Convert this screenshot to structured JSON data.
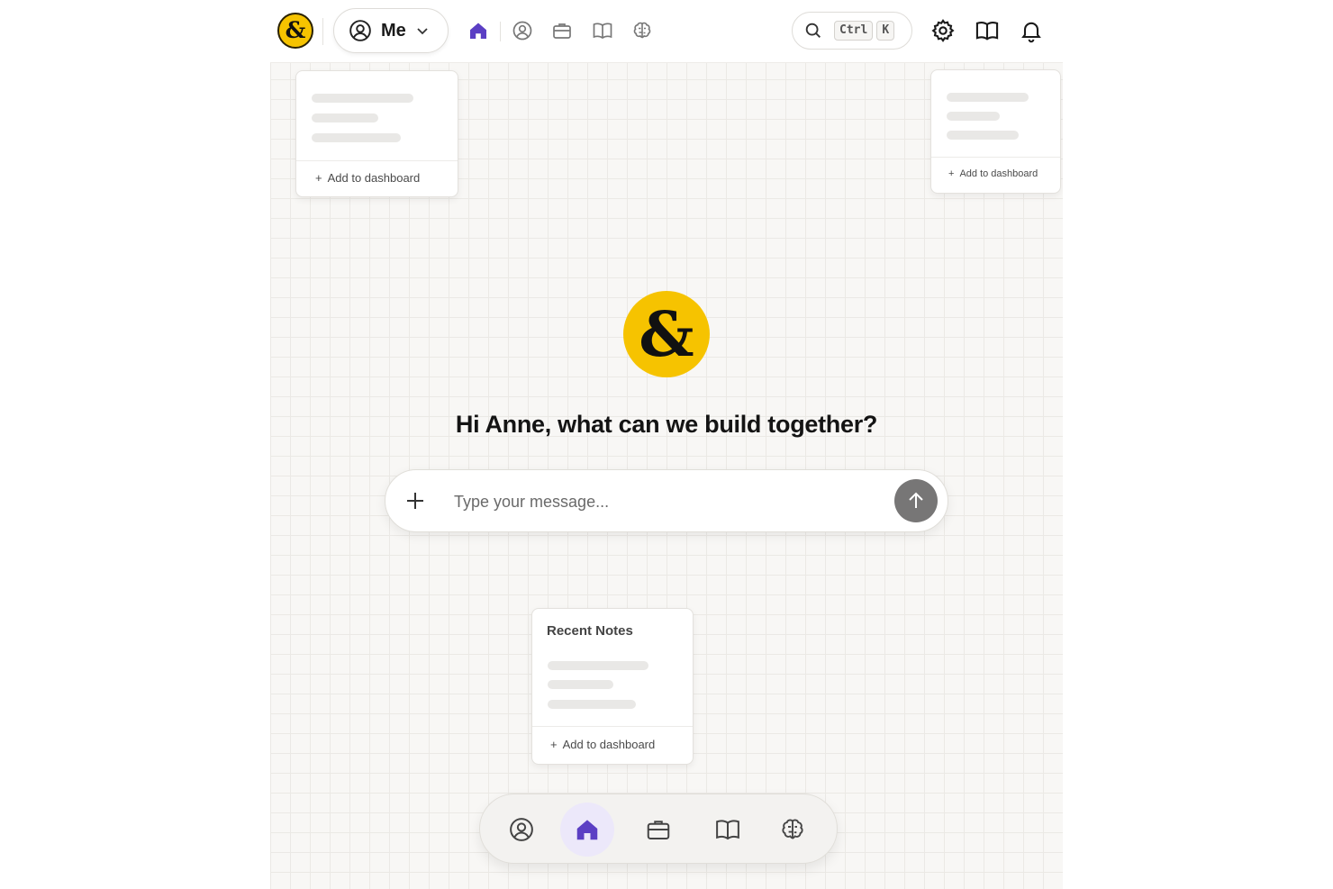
{
  "topbar": {
    "logo_name": "ampersand-logo",
    "profile_selector": {
      "label": "Me"
    },
    "nav_icons": [
      "home-icon",
      "profile-icon",
      "briefcase-icon",
      "book-icon",
      "brain-icon"
    ],
    "active_nav": "home",
    "search": {
      "shortcut_ctrl": "Ctrl",
      "shortcut_key": "K"
    },
    "right_icons": [
      "settings-icon",
      "book-icon",
      "bell-icon"
    ]
  },
  "cards": {
    "top_left": {
      "action": "Add to dashboard"
    },
    "top_right": {
      "action": "Add to dashboard"
    },
    "recent_notes": {
      "title": "Recent Notes",
      "action": "Add to dashboard"
    }
  },
  "hero": {
    "greeting": "Hi Anne, what can we build together?"
  },
  "composer": {
    "placeholder": "Type your message..."
  },
  "dock": {
    "items": [
      "profile-icon",
      "home-icon",
      "briefcase-icon",
      "book-icon",
      "brain-icon"
    ],
    "active": "home"
  },
  "colors": {
    "accent": "#5b3fc4",
    "logo_yellow": "#f6c300",
    "send_button": "#777676",
    "background": "#f8f7f5"
  }
}
